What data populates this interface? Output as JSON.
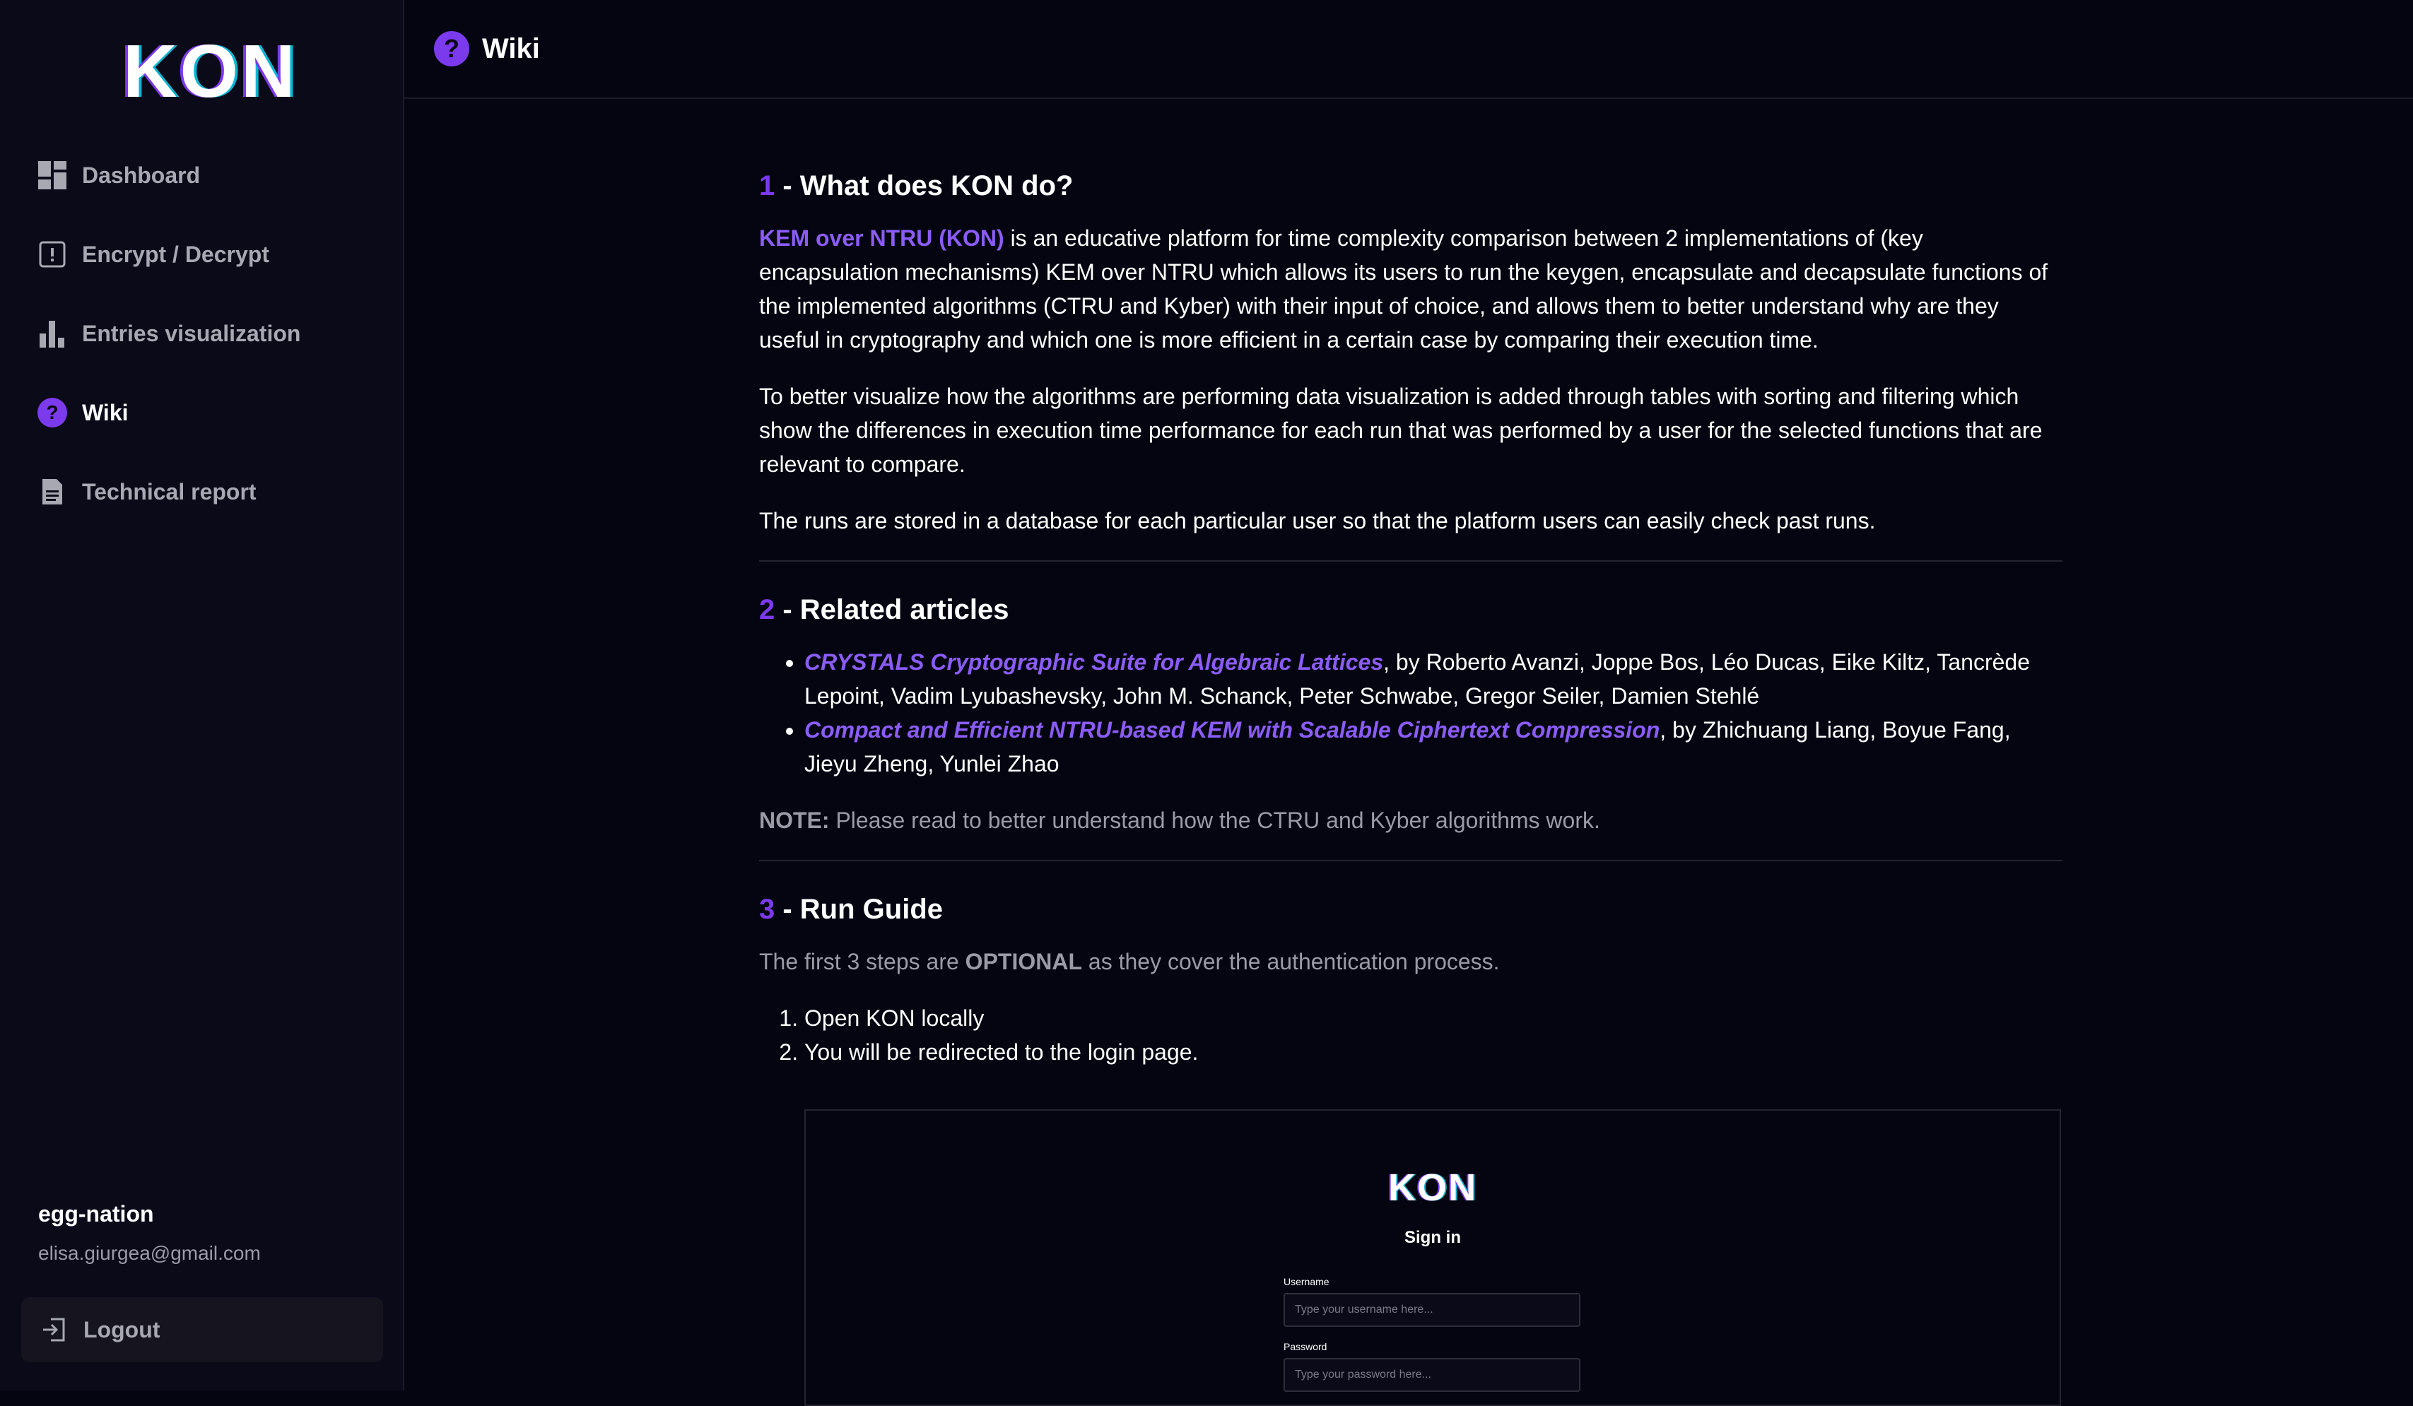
{
  "app": {
    "logo": "KON"
  },
  "sidebar": {
    "items": [
      {
        "label": "Dashboard",
        "icon": "dashboard-icon"
      },
      {
        "label": "Encrypt / Decrypt",
        "icon": "key-icon"
      },
      {
        "label": "Entries visualization",
        "icon": "bar-chart-icon"
      },
      {
        "label": "Wiki",
        "icon": "question-circle-icon",
        "active": true
      },
      {
        "label": "Technical report",
        "icon": "document-icon"
      }
    ],
    "user": {
      "name": "egg-nation",
      "email": "elisa.giurgea@gmail.com"
    },
    "logout_label": "Logout"
  },
  "header": {
    "title": "Wiki",
    "icon": "question-circle-icon"
  },
  "sections": {
    "s1": {
      "num": "1",
      "title": " - What does KON do?",
      "p1_link": "KEM over NTRU (KON)",
      "p1_rest": " is an educative platform for time complexity comparison between 2 implementations of (key encapsulation mechanisms) KEM over NTRU which allows its users to run the keygen, encapsulate and decapsulate functions of the implemented algorithms (CTRU and Kyber) with their input of choice, and allows them to better understand why are they useful in cryptography and which one is more efficient in a certain case by comparing their execution time.",
      "p2": "To better visualize how the algorithms are performing data visualization is added through tables with sorting and filtering which show the differences in execution time performance for each run that was performed by a user for the selected functions that are relevant to compare.",
      "p3": "The runs are stored in a database for each particular user so that the platform users can easily check past runs."
    },
    "s2": {
      "num": "2",
      "title": " - Related articles",
      "articles": [
        {
          "title": "CRYSTALS Cryptographic Suite for Algebraic Lattices",
          "authors": ", by Roberto Avanzi, Joppe Bos, Léo Ducas, Eike Kiltz, Tancrède Lepoint, Vadim Lyubashevsky, John M. Schanck, Peter Schwabe, Gregor Seiler, Damien Stehlé"
        },
        {
          "title": "Compact and Efficient NTRU-based KEM with Scalable Ciphertext Compression",
          "authors": ", by Zhichuang Liang, Boyue Fang, Jieyu Zheng, Yunlei Zhao"
        }
      ],
      "note_label": "NOTE:",
      "note_text": " Please read to better understand how the CTRU and Kyber algorithms work."
    },
    "s3": {
      "num": "3",
      "title": " - Run Guide",
      "intro_a": "The first 3 steps are ",
      "intro_b": "OPTIONAL",
      "intro_c": " as they cover the authentication process.",
      "steps": [
        "Open KON locally",
        "You will be redirected to the login page."
      ]
    }
  },
  "preview": {
    "logo": "KON",
    "signin": "Sign in",
    "username_label": "Username",
    "username_placeholder": "Type your username here...",
    "password_label": "Password",
    "password_placeholder": "Type your password here..."
  },
  "colors": {
    "accent": "#7c3aed",
    "background": "#050512",
    "sidebar": "#0b0a19"
  }
}
